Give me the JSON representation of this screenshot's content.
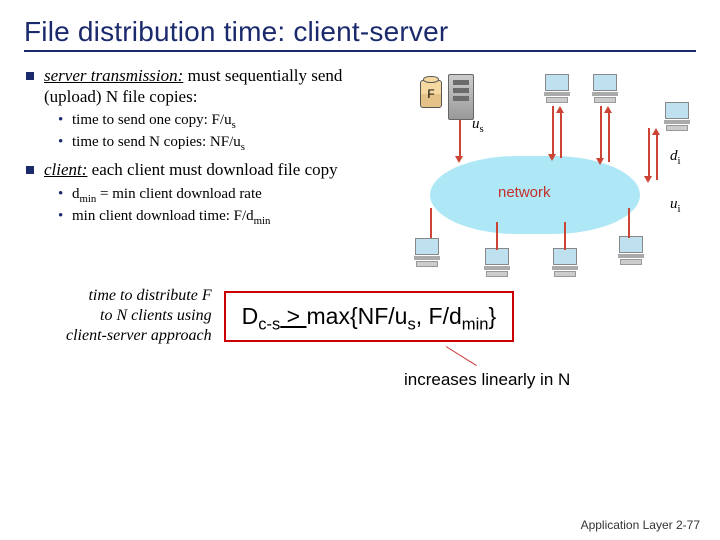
{
  "title": "File distribution time: client-server",
  "bullets": {
    "b1_head": "server transmission:",
    "b1_rest": " must sequentially send (upload) N file copies:",
    "b1_sub1_a": "time to send one copy: F/u",
    "b1_sub2_a": "time to send N copies: NF/u",
    "sub_s": "s",
    "b2_head": "client:",
    "b2_rest": " each client must download file copy",
    "b2_sub1_a": "d",
    "b2_sub1_min": "min",
    "b2_sub1_b": " = min client download rate",
    "b2_sub2_a": "min client download time: F/d",
    "b2_sub2_min": "min"
  },
  "diagram": {
    "file_label": "F",
    "us": "u",
    "us_sub": "s",
    "di": "d",
    "di_sub": "i",
    "ui": "u",
    "ui_sub": "i",
    "network": "network"
  },
  "formula": {
    "left_l1": "time to distribute F",
    "left_l2": "to N clients using",
    "left_l3": "client-server approach",
    "D": "D",
    "cs": "c-s",
    "ge": " > ",
    "maxopen": "max{NF/u",
    "s": "s",
    "mid": ", F/d",
    "min": "min",
    "close": "}"
  },
  "increases": "increases linearly in N",
  "footer_a": "Application Layer ",
  "footer_b": "2-",
  "footer_c": "77"
}
